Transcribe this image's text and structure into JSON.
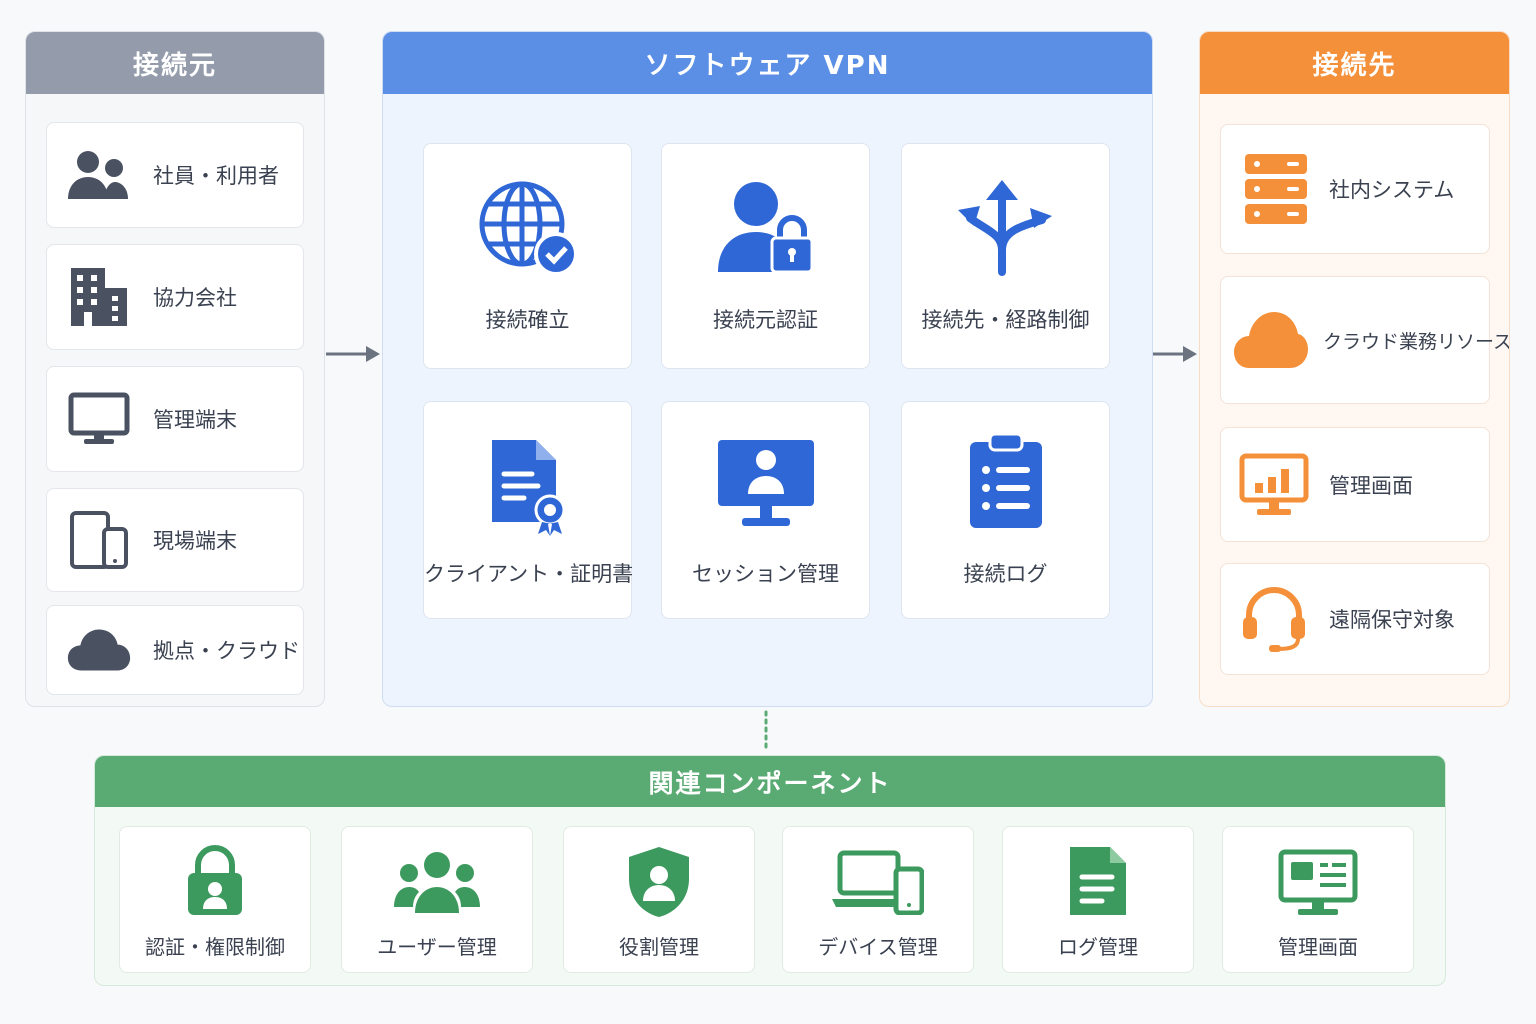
{
  "source": {
    "title": "接続元",
    "items": [
      {
        "label": "社員・利用者",
        "icon": "users-icon"
      },
      {
        "label": "協力会社",
        "icon": "building-icon"
      },
      {
        "label": "管理端末",
        "icon": "monitor-icon"
      },
      {
        "label": "現場端末",
        "icon": "mobile-devices-icon"
      },
      {
        "label": "拠点・クラウド",
        "icon": "cloud-icon"
      }
    ]
  },
  "vpn": {
    "title": "ソフトウェア VPN",
    "items": [
      {
        "label": "接続確立",
        "icon": "globe-check-icon"
      },
      {
        "label": "接続元認証",
        "icon": "user-lock-icon"
      },
      {
        "label": "接続先・経路制御",
        "icon": "route-split-icon"
      },
      {
        "label": "クライアント・証明書",
        "icon": "certificate-icon"
      },
      {
        "label": "セッション管理",
        "icon": "session-monitor-icon"
      },
      {
        "label": "接続ログ",
        "icon": "clipboard-list-icon"
      }
    ]
  },
  "destination": {
    "title": "接続先",
    "items": [
      {
        "label": "社内システム",
        "icon": "server-icon"
      },
      {
        "label": "クラウド業務リソース",
        "icon": "cloud-icon"
      },
      {
        "label": "管理画面",
        "icon": "dashboard-monitor-icon"
      },
      {
        "label": "遠隔保守対象",
        "icon": "headset-icon"
      }
    ]
  },
  "related": {
    "title": "関連コンポーネント",
    "items": [
      {
        "label": "認証・権限制御",
        "icon": "lock-user-icon"
      },
      {
        "label": "ユーザー管理",
        "icon": "user-group-icon"
      },
      {
        "label": "役割管理",
        "icon": "shield-user-icon"
      },
      {
        "label": "デバイス管理",
        "icon": "laptop-phone-icon"
      },
      {
        "label": "ログ管理",
        "icon": "document-icon"
      },
      {
        "label": "管理画面",
        "icon": "admin-monitor-icon"
      }
    ]
  },
  "colors": {
    "source": "#949cac",
    "vpn": "#5b8fe6",
    "destination": "#f5903a",
    "related": "#5aaa73",
    "icon_gray": "#4a5262",
    "icon_blue": "#2f67d6",
    "icon_orange": "#f5903a",
    "icon_green": "#3d9a5e"
  }
}
